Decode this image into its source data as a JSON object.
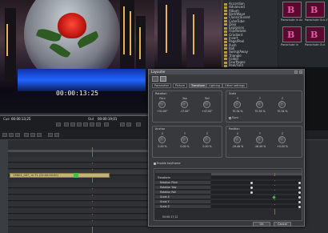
{
  "preview": {
    "timecode": "00:00:13:25",
    "cue_label": "Cue",
    "in_value": "00:00:13;25",
    "out_label": "Out",
    "out_value": "00:00:19;01"
  },
  "library": {
    "items": [
      "Accordion",
      "Advanced",
      "Album",
      "Bird/Wave",
      "Classic/Event",
      "CubeTube",
      "Door",
      "Explosion",
      "Flip/Rotate",
      "Gradient",
      "Insert",
      "Page/Peel",
      "Push",
      "Roll",
      "Swing/Away",
      "Triangle",
      "Folder",
      "FourPages",
      "Peel/Fold"
    ]
  },
  "thumbs": [
    {
      "letter": "B",
      "label": "Parachute In Ac"
    },
    {
      "letter": "B",
      "label": "Parachute Out Ac"
    },
    {
      "letter": "B",
      "label": "Parachute In"
    },
    {
      "letter": "B",
      "label": "Parachute Out"
    }
  ],
  "timeline": {
    "clip_label": "13BG1_007_ m TL  (24:00:00:00)"
  },
  "dialog": {
    "title": "Layouter",
    "tabs": [
      "Parameter",
      "Picture",
      "Transform",
      "Lighting",
      "Other settings"
    ],
    "active_tab": "Transform",
    "rotation": {
      "label": "Rotation",
      "knobs": [
        {
          "name": "Pitch",
          "value": "+51.00°"
        },
        {
          "name": "Yaw",
          "value": "-17.00°"
        },
        {
          "name": "Roll",
          "value": "+47.00°"
        }
      ]
    },
    "scale": {
      "label": "Scale",
      "knobs": [
        {
          "name": "X",
          "value": "70.34 %"
        },
        {
          "name": "Y",
          "value": "70.34 %"
        },
        {
          "name": "Z",
          "value": "70.34 %"
        }
      ],
      "sync_label": "Sync"
    },
    "anchor": {
      "label": "Anchor",
      "knobs": [
        {
          "name": "X",
          "value": "0.00 %"
        },
        {
          "name": "Y",
          "value": "0.00 %"
        },
        {
          "name": "Z",
          "value": "0.00 %"
        }
      ]
    },
    "position": {
      "label": "Position",
      "knobs": [
        {
          "name": "X",
          "value": "-19.46 %"
        },
        {
          "name": "Y",
          "value": "-16.49 %"
        },
        {
          "name": "Z",
          "value": "+0.00 %"
        }
      ]
    },
    "enable_keyframe": "Enable keyframe",
    "kf_rows": [
      {
        "label": "Transform",
        "kind": "head"
      },
      {
        "label": "Rotation Pitch",
        "kind": "row"
      },
      {
        "label": "Rotation Yaw",
        "kind": "row"
      },
      {
        "label": "Rotation Roll",
        "kind": "row"
      },
      {
        "label": "Scale X",
        "kind": "row"
      },
      {
        "label": "Scale Y",
        "kind": "row"
      },
      {
        "label": "Scale Z",
        "kind": "row"
      }
    ],
    "kf_time": "00:00:17;12",
    "ok_label": "OK",
    "cancel_label": "Cancel"
  }
}
